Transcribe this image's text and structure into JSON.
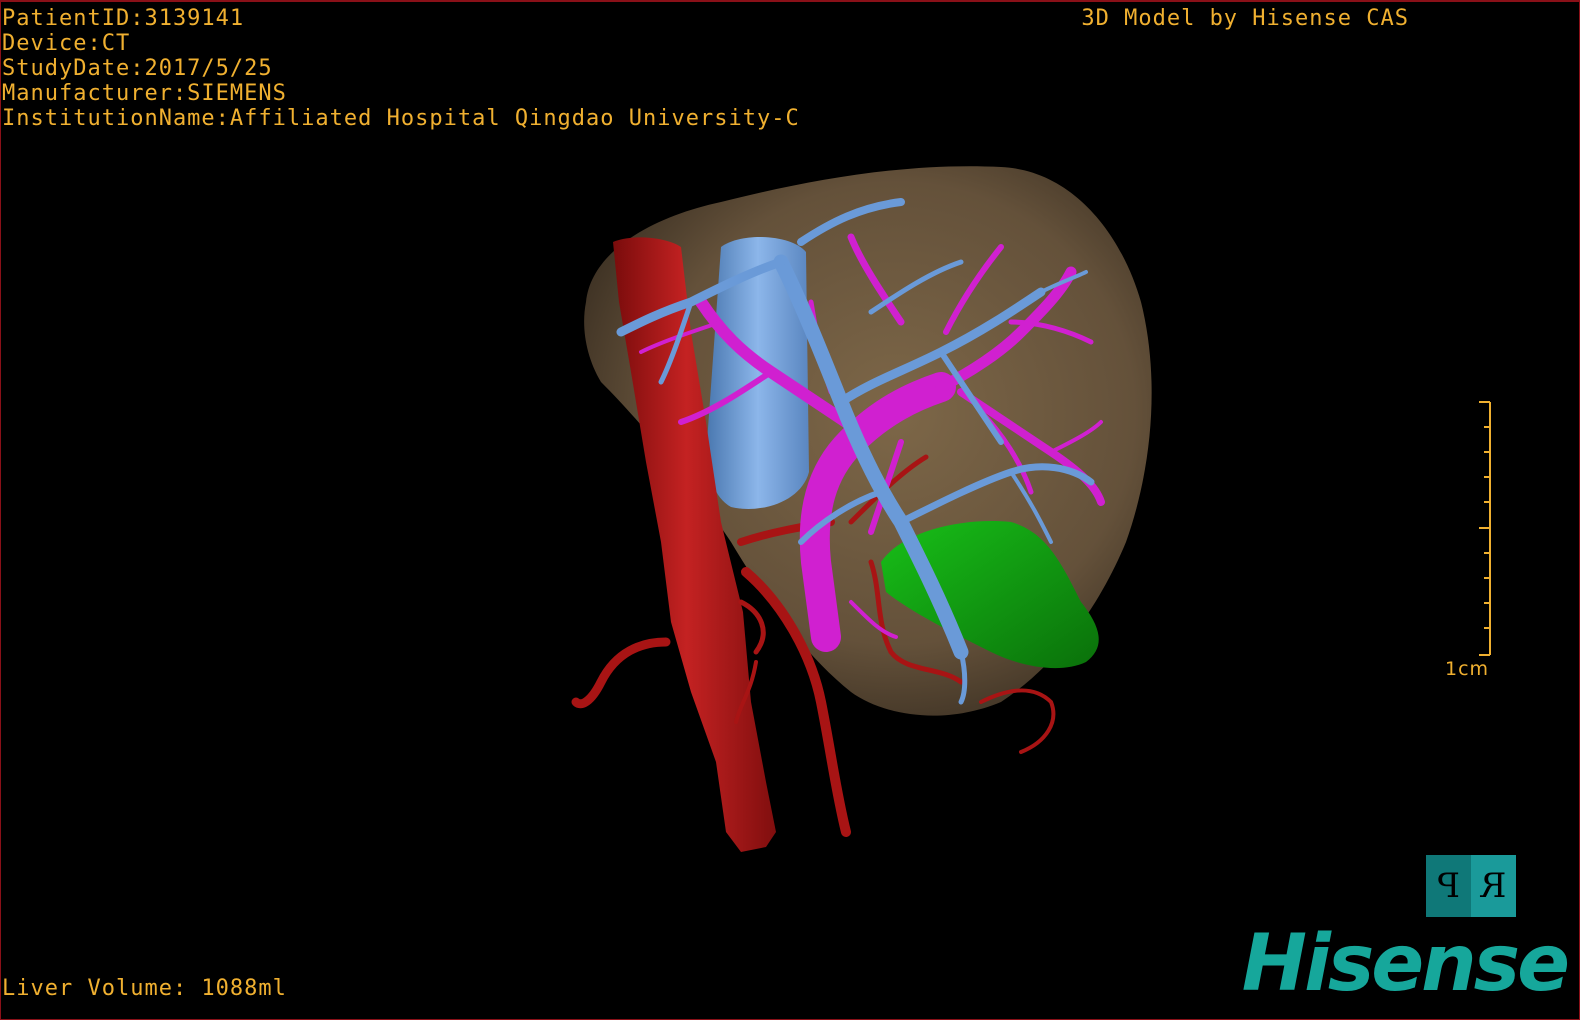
{
  "overlay": {
    "patient_id": "PatientID:3139141",
    "device": "Device:CT",
    "study_date": "StudyDate:2017/5/25",
    "manufacturer": "Manufacturer:SIEMENS",
    "institution": "InstitutionName:Affiliated Hospital Qingdao University-C",
    "credit": "3D Model by Hisense CAS",
    "liver_volume": "Liver Volume: 1088ml"
  },
  "scale_bar": {
    "label": "1cm"
  },
  "orientation_cube": {
    "left_face": "P",
    "right_face": "R"
  },
  "logo": {
    "text": "Hisense"
  },
  "colors": {
    "overlay_text": "#f0b030",
    "liver": "#6e5a40",
    "artery": "#b01818",
    "portal_vein": "#d020d0",
    "hepatic_vein": "#6a9ad8",
    "gallbladder": "#10a010",
    "brand": "#16a79b",
    "frame": "#8a1018"
  }
}
